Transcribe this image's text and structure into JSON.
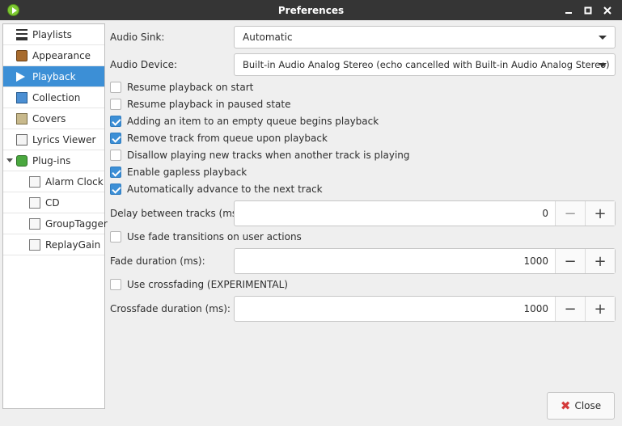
{
  "window": {
    "title": "Preferences"
  },
  "sidebar": {
    "items": [
      {
        "label": "Playlists",
        "icon": "playlist-icon"
      },
      {
        "label": "Appearance",
        "icon": "appearance-icon"
      },
      {
        "label": "Playback",
        "icon": "play-icon",
        "selected": true
      },
      {
        "label": "Collection",
        "icon": "collection-icon"
      },
      {
        "label": "Covers",
        "icon": "covers-icon"
      },
      {
        "label": "Lyrics Viewer",
        "icon": "lyrics-icon"
      },
      {
        "label": "Plug-ins",
        "icon": "plugin-icon",
        "expanded": true
      },
      {
        "label": "Alarm Clock",
        "icon": "document-icon"
      },
      {
        "label": "CD",
        "icon": "document-icon"
      },
      {
        "label": "GroupTagger",
        "icon": "document-icon"
      },
      {
        "label": "ReplayGain",
        "icon": "document-icon"
      }
    ]
  },
  "playback": {
    "audio_sink_label": "Audio Sink:",
    "audio_sink_value": "Automatic",
    "audio_device_label": "Audio Device:",
    "audio_device_value": "Built-in Audio Analog Stereo (echo cancelled with Built-in Audio Analog Stereo)",
    "options": [
      {
        "label": "Resume playback on start",
        "checked": false
      },
      {
        "label": "Resume playback in paused state",
        "checked": false
      },
      {
        "label": "Adding an item to an empty queue begins playback",
        "checked": true
      },
      {
        "label": "Remove track from queue upon playback",
        "checked": true
      },
      {
        "label": "Disallow playing new tracks when another track is playing",
        "checked": false
      },
      {
        "label": "Enable gapless playback",
        "checked": true
      },
      {
        "label": "Automatically advance to the next track",
        "checked": true
      }
    ],
    "delay_label": "Delay between tracks (ms):",
    "delay_value": "0",
    "fade_option": {
      "label": "Use fade transitions on user actions",
      "checked": false
    },
    "fade_label": "Fade duration (ms):",
    "fade_value": "1000",
    "crossfade_option": {
      "label": "Use crossfading (EXPERIMENTAL)",
      "checked": false
    },
    "crossfade_label": "Crossfade duration (ms):",
    "crossfade_value": "1000"
  },
  "footer": {
    "close_label": "Close"
  },
  "colors": {
    "titlebar": "#353535",
    "selection": "#3c8fd6",
    "close_icon": "#d43a3a"
  }
}
